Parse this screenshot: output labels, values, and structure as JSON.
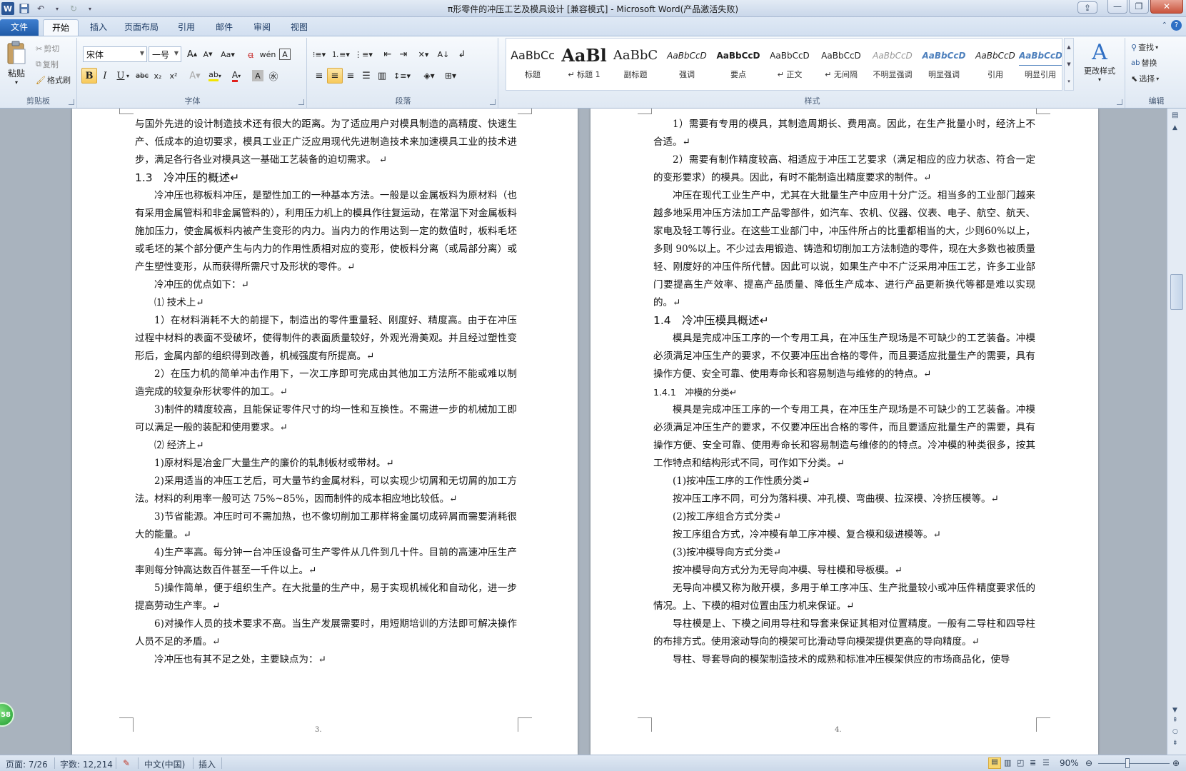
{
  "window": {
    "title": "π形零件的冲压工艺及模具设计 [兼容模式] - Microsoft Word(产品激活失败)"
  },
  "tabs": [
    "文件",
    "开始",
    "插入",
    "页面布局",
    "引用",
    "邮件",
    "审阅",
    "视图"
  ],
  "clipboard": {
    "paste": "粘贴",
    "cut": "剪切",
    "copy": "复制",
    "format_painter": "格式刷",
    "label": "剪贴板"
  },
  "font": {
    "name": "宋体",
    "size": "一号",
    "label": "字体"
  },
  "paragraph": {
    "label": "段落"
  },
  "styles": {
    "label": "样式",
    "items": [
      {
        "preview": "AaBbCc",
        "name": "标题"
      },
      {
        "preview": "AaBl",
        "name": "↵ 标题 1"
      },
      {
        "preview": "AaBbC",
        "name": "副标题"
      },
      {
        "preview": "AaBbCcD",
        "name": "强调"
      },
      {
        "preview": "AaBbCcD",
        "name": "要点"
      },
      {
        "preview": "AaBbCcD",
        "name": "↵ 正文"
      },
      {
        "preview": "AaBbCcD",
        "name": "↵ 无间隔"
      },
      {
        "preview": "AaBbCcD",
        "name": "不明显强调"
      },
      {
        "preview": "AaBbCcD",
        "name": "明显强调"
      },
      {
        "preview": "AaBbCcD",
        "name": "引用"
      },
      {
        "preview": "AaBbCcD",
        "name": "明显引用"
      }
    ],
    "change_styles": "更改样式"
  },
  "editing": {
    "find": "查找",
    "replace": "替换",
    "select": "选择",
    "label": "编辑"
  },
  "page_left": {
    "number": "3.",
    "paragraphs": [
      {
        "kind": "noind",
        "text": "与国外先进的设计制造技术还有很大的距离。为了适应用户对模具制造的高精度、快速生产、低成本的迫切要求，模具工业正广泛应用现代先进制造技术来加速模具工业的技术进步，满足各行各业对模具这一基础工艺装备的迫切需求。 ↵"
      },
      {
        "kind": "h2",
        "text": "1.3　冷冲压的概述↵"
      },
      {
        "kind": "p",
        "text": "冷冲压也称板料冲压，是塑性加工的一种基本方法。一般是以金属板料为原材料（也有采用金属管料和非金属管料的），利用压力机上的模具作往复运动，在常温下对金属板料施加压力，使金属板料内被产生变形的内力。当内力的作用达到一定的数值时，板料毛坯或毛坯的某个部分便产生与内力的作用性质相对应的变形，使板料分离（或局部分离）或产生塑性变形，从而获得所需尺寸及形状的零件。↵"
      },
      {
        "kind": "p",
        "text": "冷冲压的优点如下：↵"
      },
      {
        "kind": "p",
        "text": "⑴ 技术上↵"
      },
      {
        "kind": "p",
        "text": "1）在材料消耗不大的前提下，制造出的零件重量轻、刚度好、精度高。由于在冲压过程中材料的表面不受破坏，使得制件的表面质量较好，外观光滑美观。并且经过塑性变形后，金属内部的组织得到改善，机械强度有所提高。↵"
      },
      {
        "kind": "p",
        "text": "2）在压力机的简单冲击作用下，一次工序即可完成由其他加工方法所不能或难以制造完成的较复杂形状零件的加工。↵"
      },
      {
        "kind": "p",
        "text": "3)制件的精度较高，且能保证零件尺寸的均一性和互换性。不需进一步的机械加工即可以满足一般的装配和使用要求。↵"
      },
      {
        "kind": "p",
        "text": "⑵ 经济上↵"
      },
      {
        "kind": "p",
        "text": "1)原材料是冶金厂大量生产的廉价的轧制板材或带材。↵"
      },
      {
        "kind": "p",
        "text": "2)采用适当的冲压工艺后，可大量节约金属材料，可以实现少切屑和无切屑的加工方法。材料的利用率一般可达 75%~85%，因而制件的成本相应地比较低。↵"
      },
      {
        "kind": "p",
        "text": "3)节省能源。冲压时可不需加热，也不像切削加工那样将金属切成碎屑而需要消耗很大的能量。↵"
      },
      {
        "kind": "p",
        "text": "4)生产率高。每分钟一台冲压设备可生产零件从几件到几十件。目前的高速冲压生产率则每分钟高达数百件甚至一千件以上。↵"
      },
      {
        "kind": "p",
        "text": "5)操作简单，便于组织生产。在大批量的生产中，易于实现机械化和自动化，进一步提高劳动生产率。↵"
      },
      {
        "kind": "p",
        "text": "6)对操作人员的技术要求不高。当生产发展需要时，用短期培训的方法即可解决操作人员不足的矛盾。↵"
      },
      {
        "kind": "p",
        "text": "冷冲压也有其不足之处，主要缺点为：↵"
      }
    ]
  },
  "page_right": {
    "number": "4.",
    "paragraphs": [
      {
        "kind": "p",
        "text": "1）需要有专用的模具，其制造周期长、费用高。因此，在生产批量小时，经济上不合适。↵"
      },
      {
        "kind": "p",
        "text": "2）需要有制作精度较高、相适应于冲压工艺要求（满足相应的应力状态、符合一定的变形要求）的模具。因此，有时不能制造出精度要求的制件。↵"
      },
      {
        "kind": "p",
        "text": "冲压在现代工业生产中，尤其在大批量生产中应用十分广泛。相当多的工业部门越来越多地采用冲压方法加工产品零部件，如汽车、农机、仪器、仪表、电子、航空、航天、家电及轻工等行业。在这些工业部门中，冲压件所占的比重都相当的大，少则60%以上，多则 90%以上。不少过去用锻造、铸造和切削加工方法制造的零件，现在大多数也被质量轻、刚度好的冲压件所代替。因此可以说，如果生产中不广泛采用冲压工艺，许多工业部门要提高生产效率、提高产品质量、降低生产成本、进行产品更新换代等都是难以实现的。↵"
      },
      {
        "kind": "h2",
        "text": "1.4　冷冲压模具概述↵"
      },
      {
        "kind": "p",
        "text": "模具是完成冲压工序的一个专用工具，在冲压生产现场是不可缺少的工艺装备。冲模必须满足冲压生产的要求，不仅要冲压出合格的零件，而且要适应批量生产的需要，具有操作方便、安全可靠、使用寿命长和容易制造与维修的的特点。↵"
      },
      {
        "kind": "h3",
        "text": "1.4.1　冲模的分类↵"
      },
      {
        "kind": "p",
        "text": "模具是完成冲压工序的一个专用工具，在冲压生产现场是不可缺少的工艺装备。冲模必须满足冲压生产的要求，不仅要冲压出合格的零件，而且要适应批量生产的需要，具有操作方便、安全可靠、使用寿命长和容易制造与维修的的特点。冷冲模的种类很多，按其工作特点和结构形式不同，可作如下分类。↵"
      },
      {
        "kind": "p",
        "text": "(1)按冲压工序的工作性质分类↵"
      },
      {
        "kind": "p",
        "text": "按冲压工序不同，可分为落料模、冲孔模、弯曲模、拉深模、冷挤压模等。↵"
      },
      {
        "kind": "p",
        "text": "(2)按工序组合方式分类↵"
      },
      {
        "kind": "p",
        "text": "按工序组合方式，冷冲模有单工序冲模、复合模和级进模等。↵"
      },
      {
        "kind": "p",
        "text": "(3)按冲模导向方式分类↵"
      },
      {
        "kind": "p",
        "text": "按冲模导向方式分为无导向冲模、导柱模和导板模。↵"
      },
      {
        "kind": "p",
        "text": "无导向冲模又称为敞开模，多用于单工序冲压、生产批量较小或冲压件精度要求低的情况。上、下模的相对位置由压力机来保证。↵"
      },
      {
        "kind": "p",
        "text": "导柱模是上、下模之间用导柱和导套来保证其相对位置精度。一般有二导柱和四导柱的布排方式。使用滚动导向的模架可比滑动导向模架提供更高的导向精度。↵"
      },
      {
        "kind": "p",
        "text": "导柱、导套导向的模架制造技术的成熟和标准冲压模架供应的市场商品化，使导"
      }
    ]
  },
  "status": {
    "page": "页面: 7/26",
    "words": "字数: 12,214",
    "language": "中文(中国)",
    "mode": "插入",
    "zoom": "90%"
  },
  "badge": "58"
}
